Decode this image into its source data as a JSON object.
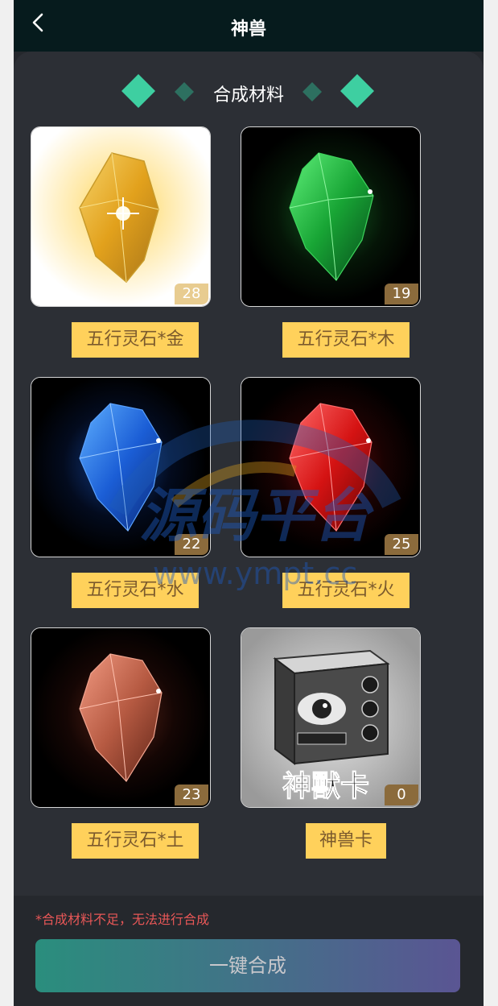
{
  "header": {
    "title": "神兽"
  },
  "section": {
    "title": "合成材料"
  },
  "materials": [
    {
      "label": "五行灵石*金",
      "count": "28",
      "icon": "gold-crystal-icon",
      "color": "#e0a727"
    },
    {
      "label": "五行灵石*木",
      "count": "19",
      "icon": "green-crystal-icon",
      "color": "#23b23d"
    },
    {
      "label": "五行灵石*水",
      "count": "22",
      "icon": "blue-crystal-icon",
      "color": "#1b5ed6"
    },
    {
      "label": "五行灵石*火",
      "count": "25",
      "icon": "red-crystal-icon",
      "color": "#d51313"
    },
    {
      "label": "五行灵石*土",
      "count": "23",
      "icon": "earth-crystal-icon",
      "color": "#b65a42"
    },
    {
      "label": "神兽卡",
      "count": "0",
      "icon": "beast-card-box-icon",
      "card_text": "神獸卡",
      "color": "#999999"
    }
  ],
  "footer": {
    "warning": "*合成材料不足，无法进行合成",
    "button_label": "一键合成"
  },
  "watermark": {
    "title": "源码平台",
    "url": "www.ympt.cc"
  },
  "colors": {
    "accent": "#3ecfa1",
    "label_bg": "#ffd15b",
    "label_text": "#7b5a2d"
  }
}
